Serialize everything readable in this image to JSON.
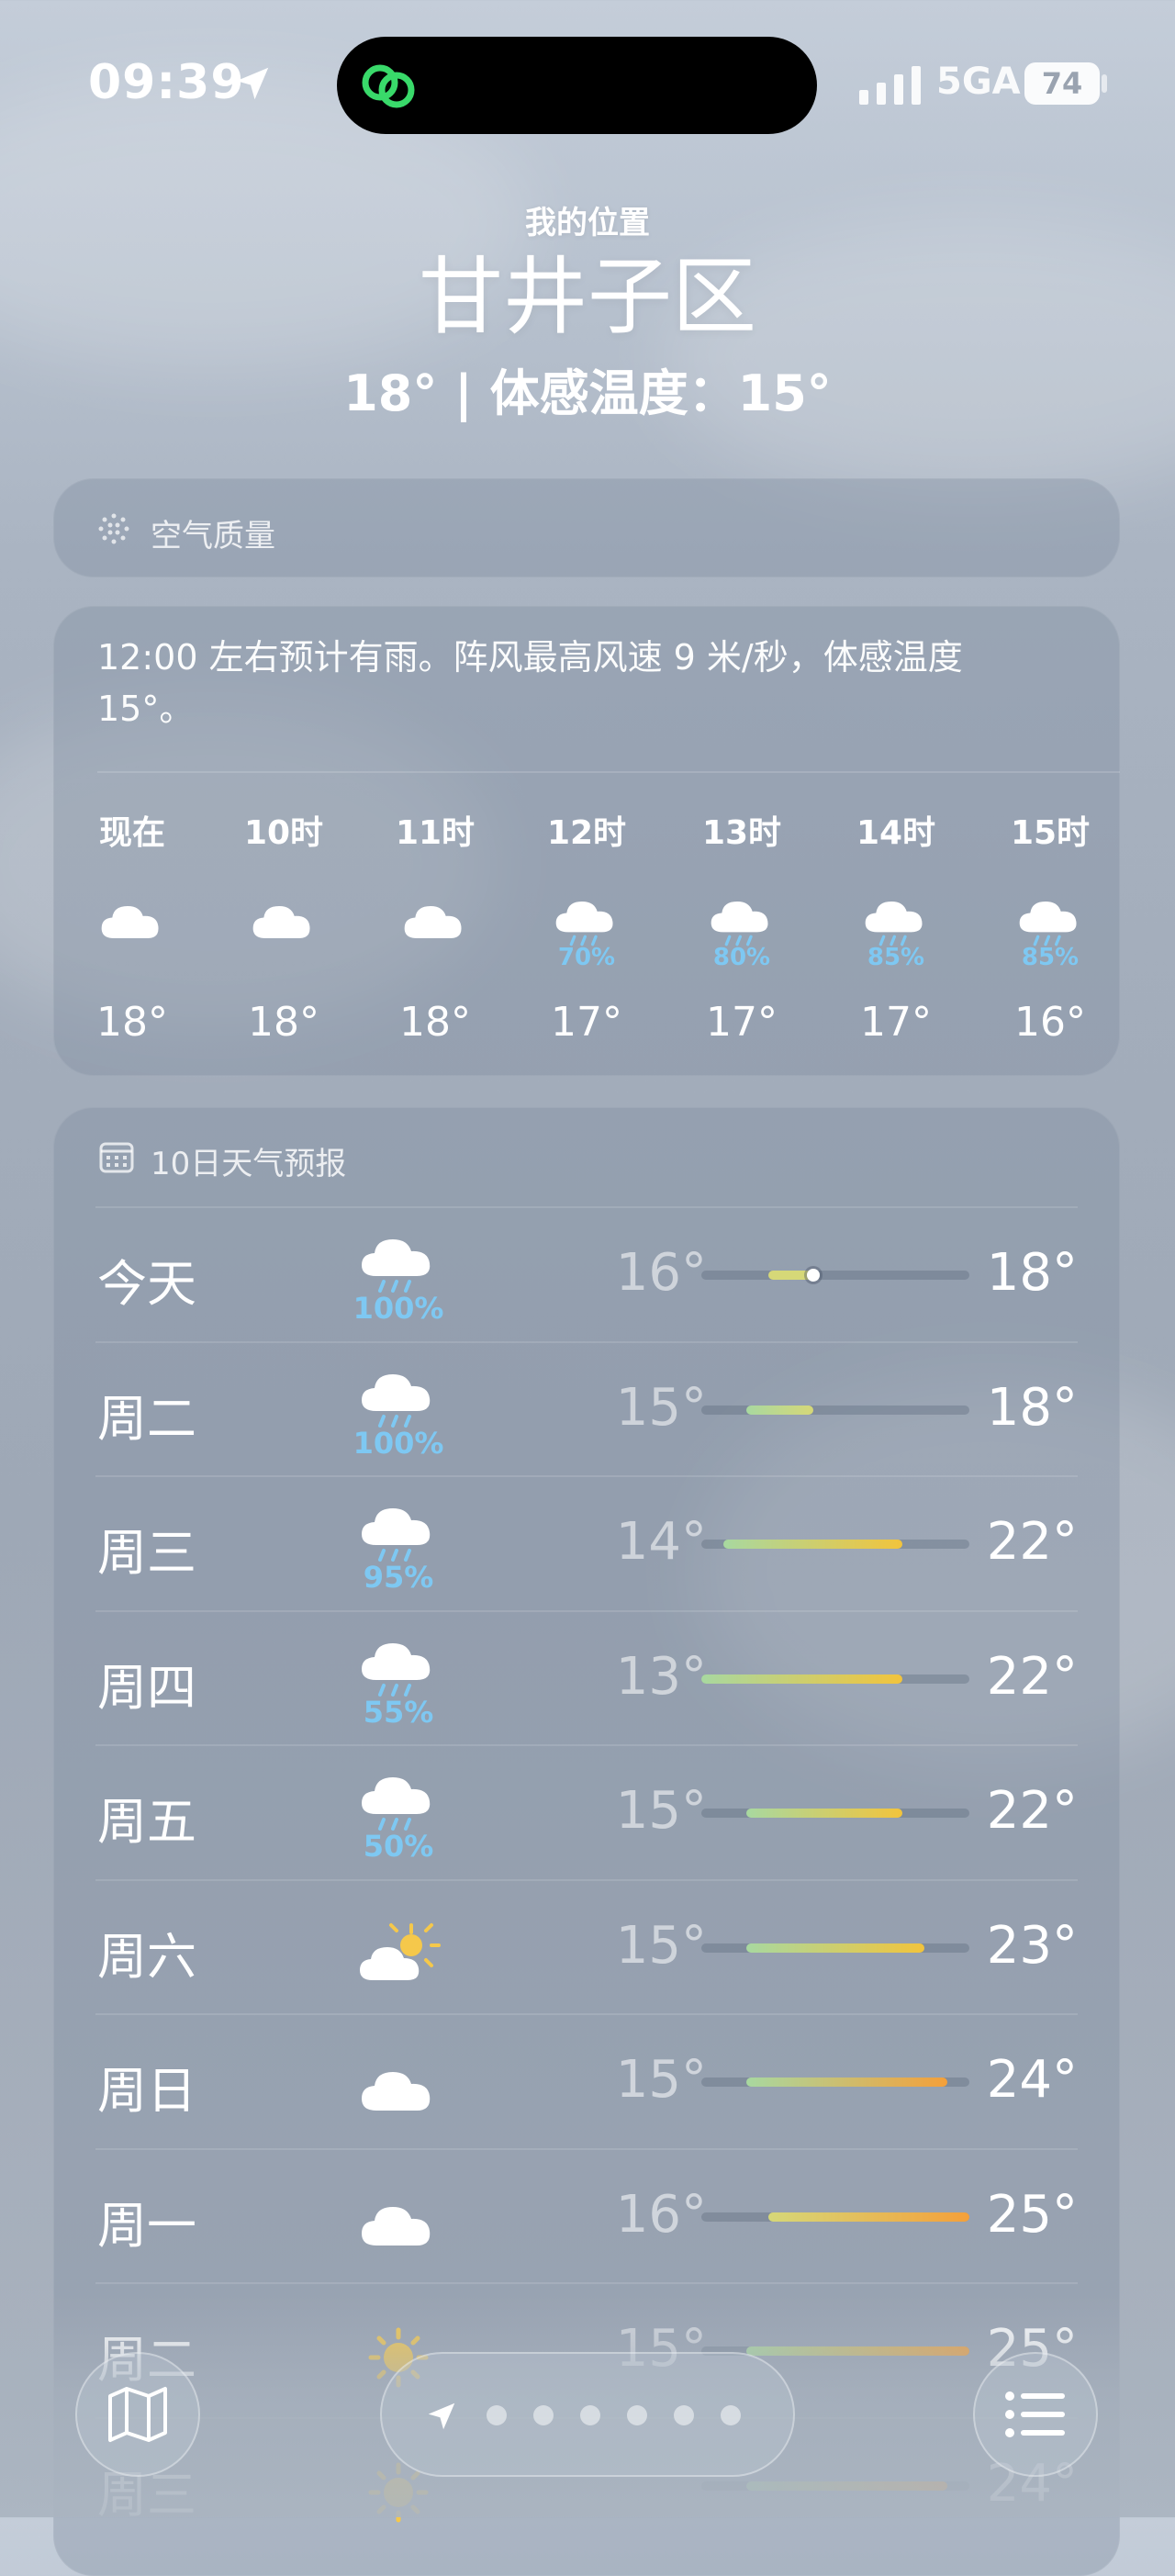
{
  "status_bar": {
    "time": "09:39",
    "network": "5GA",
    "battery": "74"
  },
  "header": {
    "location_label": "我的位置",
    "city": "甘井子区",
    "temperature_line": "18° | 体感温度：15°"
  },
  "air_quality": {
    "label": "空气质量",
    "icon": "air-quality-dots-icon"
  },
  "hourly": {
    "summary": "12:00 左右预计有雨。阵风最高风速 9 米/秒，体感温度 15°。",
    "items": [
      {
        "label": "现在",
        "icon": "cloud-icon",
        "precip": "",
        "temp": "18°"
      },
      {
        "label": "10时",
        "icon": "cloud-icon",
        "precip": "",
        "temp": "18°"
      },
      {
        "label": "11时",
        "icon": "cloud-icon",
        "precip": "",
        "temp": "18°"
      },
      {
        "label": "12时",
        "icon": "cloud-rain-icon",
        "precip": "70%",
        "temp": "17°"
      },
      {
        "label": "13时",
        "icon": "cloud-rain-icon",
        "precip": "80%",
        "temp": "17°"
      },
      {
        "label": "14时",
        "icon": "cloud-rain-icon",
        "precip": "85%",
        "temp": "17°"
      },
      {
        "label": "15时",
        "icon": "cloud-rain-icon",
        "precip": "85%",
        "temp": "16°"
      }
    ]
  },
  "daily": {
    "title": "10日天气预报",
    "range": {
      "min": 13,
      "max": 25
    },
    "colors": {
      "cool": "#a8d8a0",
      "mild": "#d6d878",
      "warm": "#f2c43c",
      "hot": "#f4a03a"
    },
    "items": [
      {
        "day": "今天",
        "icon": "cloud-rain-icon",
        "precip": "100%",
        "low": "16°",
        "high": "18°",
        "low_val": 16,
        "high_val": 18,
        "current_val": 18
      },
      {
        "day": "周二",
        "icon": "cloud-rain-icon",
        "precip": "100%",
        "low": "15°",
        "high": "18°",
        "low_val": 15,
        "high_val": 18
      },
      {
        "day": "周三",
        "icon": "cloud-rain-icon",
        "precip": "95%",
        "low": "14°",
        "high": "22°",
        "low_val": 14,
        "high_val": 22
      },
      {
        "day": "周四",
        "icon": "cloud-rain-icon",
        "precip": "55%",
        "low": "13°",
        "high": "22°",
        "low_val": 13,
        "high_val": 22
      },
      {
        "day": "周五",
        "icon": "cloud-rain-icon",
        "precip": "50%",
        "low": "15°",
        "high": "22°",
        "low_val": 15,
        "high_val": 22
      },
      {
        "day": "周六",
        "icon": "partly-sunny-icon",
        "precip": "",
        "low": "15°",
        "high": "23°",
        "low_val": 15,
        "high_val": 23
      },
      {
        "day": "周日",
        "icon": "cloud-icon",
        "precip": "",
        "low": "15°",
        "high": "24°",
        "low_val": 15,
        "high_val": 24
      },
      {
        "day": "周一",
        "icon": "cloud-icon",
        "precip": "",
        "low": "16°",
        "high": "25°",
        "low_val": 16,
        "high_val": 25
      },
      {
        "day": "周二",
        "icon": "sun-icon",
        "precip": "",
        "low": "15°",
        "high": "25°",
        "low_val": 15,
        "high_val": 25
      },
      {
        "day": "周三",
        "icon": "sun-icon",
        "precip": "",
        "low": "",
        "high": "24°",
        "low_val": 15,
        "high_val": 24
      }
    ]
  },
  "toolbar": {
    "left_icon": "map-icon",
    "center_icon": "location-arrow-icon",
    "page_dots": 6,
    "right_icon": "list-icon"
  }
}
